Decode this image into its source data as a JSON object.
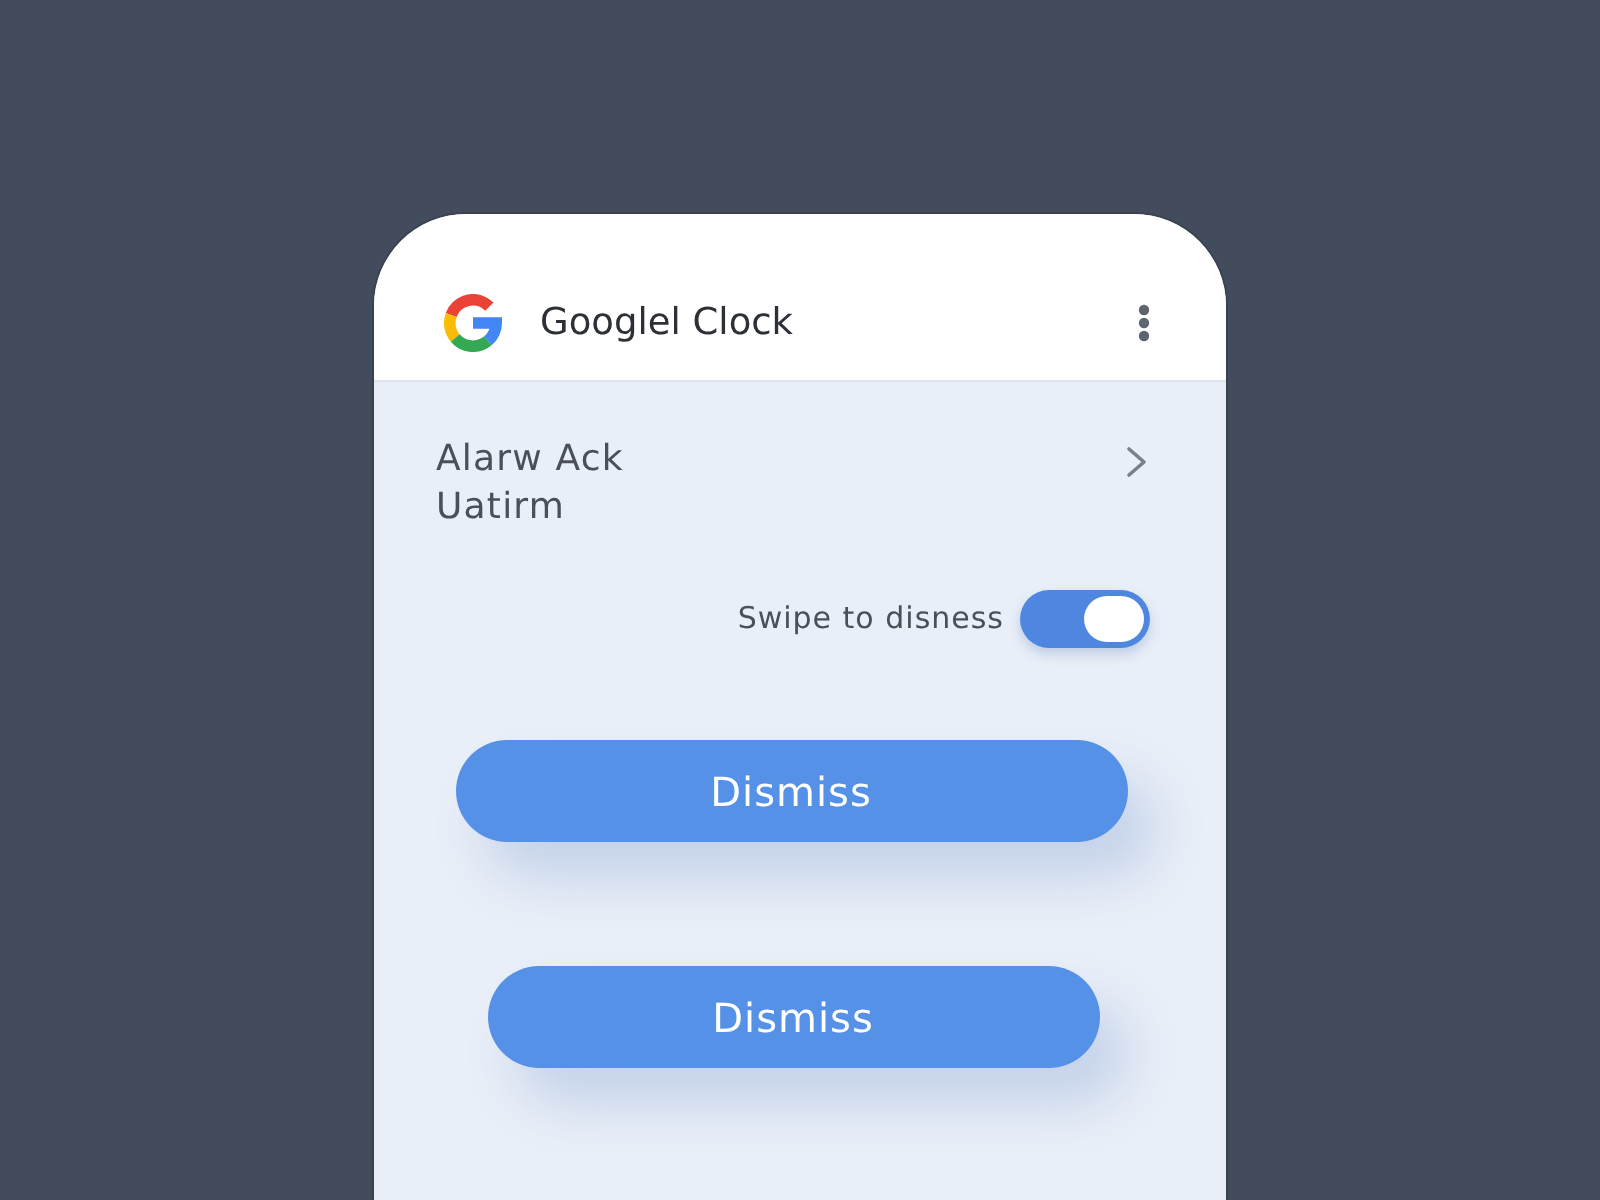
{
  "app_bar": {
    "title": "Googlel Clock"
  },
  "alarm": {
    "title": "Alarw Ack",
    "subtitle": "Uatirm"
  },
  "swipe_to_dismiss": {
    "label": "Swipe to disness",
    "on": true
  },
  "buttons": [
    {
      "label": "Dismiss"
    },
    {
      "label": "Dismiss"
    }
  ]
}
